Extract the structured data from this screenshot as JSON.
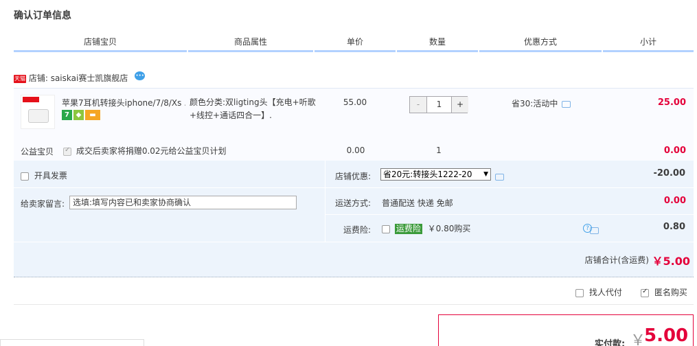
{
  "page_title": "确认订单信息",
  "columns": [
    "店铺宝贝",
    "商品属性",
    "单价",
    "数量",
    "优惠方式",
    "小计"
  ],
  "shop": {
    "badge": "天猫",
    "label": "店铺:",
    "name": "saiskai赛士凯旗舰店"
  },
  "item": {
    "name": "苹果7耳机转接头iphone/7/8/Xs ...",
    "attr_label": "颜色分类:",
    "attr_value": "双ligting头【充电+听歌+线控+通话四合一】.",
    "price": "55.00",
    "quantity": "1",
    "qty_minus": "-",
    "qty_plus": "+",
    "promo": "省30:活动中",
    "subtotal": "25.00"
  },
  "charity": {
    "label": "公益宝贝",
    "text": "成交后卖家将捐赠0.02元给公益宝贝计划",
    "price": "0.00",
    "qty": "1",
    "subtotal": "0.00"
  },
  "invoice": {
    "label": "开具发票"
  },
  "shop_discount": {
    "label": "店铺优惠:",
    "selected": "省20元:转接头1222-20",
    "amount": "-20.00"
  },
  "message": {
    "label": "给卖家留言:",
    "placeholder": "选填:填写内容已和卖家协商确认"
  },
  "shipping": {
    "label": "运送方式:",
    "value": "普通配送 快递 免邮",
    "amount": "0.00"
  },
  "insurance": {
    "label": "运费险:",
    "tag": "运费险",
    "price": "￥0.80购买",
    "amount": "0.80"
  },
  "shop_total": {
    "label": "店铺合计(含运费)",
    "value": "￥5.00"
  },
  "options": {
    "proxy_pay": "找人代付",
    "anonymous": "匿名购买"
  },
  "payment": {
    "label": "实付款:",
    "yen": "￥",
    "amount": "5.00"
  }
}
